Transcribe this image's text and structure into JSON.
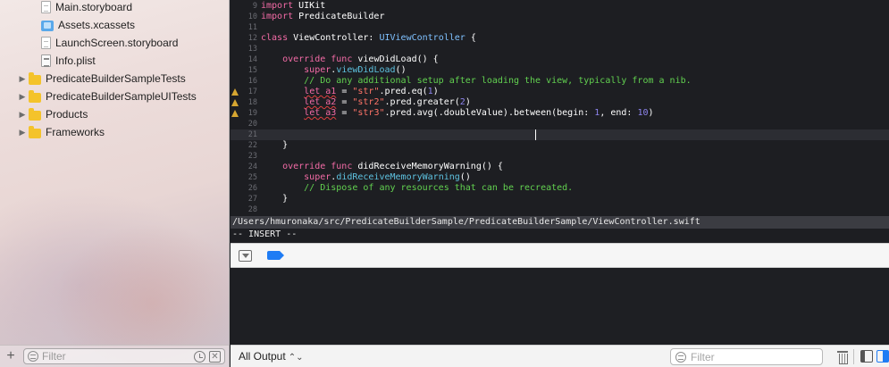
{
  "navigator": {
    "items": [
      {
        "label": "Main.storyboard",
        "icon": "storyboard-file-icon",
        "disclosure": ""
      },
      {
        "label": "Assets.xcassets",
        "icon": "asset-catalog-icon",
        "disclosure": ""
      },
      {
        "label": "LaunchScreen.storyboard",
        "icon": "storyboard-file-icon",
        "disclosure": ""
      },
      {
        "label": "Info.plist",
        "icon": "plist-file-icon",
        "disclosure": ""
      },
      {
        "label": "PredicateBuilderSampleTests",
        "icon": "folder-icon",
        "disclosure": "▶"
      },
      {
        "label": "PredicateBuilderSampleUITests",
        "icon": "folder-icon",
        "disclosure": "▶"
      },
      {
        "label": "Products",
        "icon": "folder-icon",
        "disclosure": "▶"
      },
      {
        "label": "Frameworks",
        "icon": "folder-icon",
        "disclosure": "▶"
      }
    ],
    "add_label": "+",
    "filter_placeholder": "Filter"
  },
  "editor": {
    "lines": [
      {
        "n": "9",
        "parts": [
          {
            "t": "import",
            "c": "kw"
          },
          {
            "t": " UIKit",
            "c": ""
          }
        ]
      },
      {
        "n": "10",
        "parts": [
          {
            "t": "import",
            "c": "kw"
          },
          {
            "t": " PredicateBuilder",
            "c": ""
          }
        ]
      },
      {
        "n": "11",
        "parts": []
      },
      {
        "n": "12",
        "parts": [
          {
            "t": "class",
            "c": "kw"
          },
          {
            "t": " ViewController: ",
            "c": ""
          },
          {
            "t": "UIViewController",
            "c": "ty"
          },
          {
            "t": " {",
            "c": ""
          }
        ]
      },
      {
        "n": "13",
        "parts": []
      },
      {
        "n": "14",
        "parts": [
          {
            "t": "    override func",
            "c": "kw"
          },
          {
            "t": " viewDidLoad() {",
            "c": ""
          }
        ]
      },
      {
        "n": "15",
        "parts": [
          {
            "t": "        super",
            "c": "kw"
          },
          {
            "t": ".",
            "c": ""
          },
          {
            "t": "viewDidLoad",
            "c": "fn"
          },
          {
            "t": "()",
            "c": ""
          }
        ]
      },
      {
        "n": "16",
        "parts": [
          {
            "t": "        // Do any additional setup after loading the view, typically from a nib.",
            "c": "cm"
          }
        ]
      },
      {
        "n": "17",
        "warn": true,
        "parts": [
          {
            "t": "        ",
            "c": ""
          },
          {
            "t": "let a1",
            "c": "kw wavy"
          },
          {
            "t": " = ",
            "c": ""
          },
          {
            "t": "\"str\"",
            "c": "str"
          },
          {
            "t": ".pred.eq(",
            "c": ""
          },
          {
            "t": "1",
            "c": "num"
          },
          {
            "t": ")",
            "c": ""
          }
        ]
      },
      {
        "n": "18",
        "warn": true,
        "parts": [
          {
            "t": "        ",
            "c": ""
          },
          {
            "t": "let a2",
            "c": "kw wavy"
          },
          {
            "t": " = ",
            "c": ""
          },
          {
            "t": "\"str2\"",
            "c": "str"
          },
          {
            "t": ".pred.greater(",
            "c": ""
          },
          {
            "t": "2",
            "c": "num"
          },
          {
            "t": ")",
            "c": ""
          }
        ]
      },
      {
        "n": "19",
        "warn": true,
        "parts": [
          {
            "t": "        ",
            "c": ""
          },
          {
            "t": "let a3",
            "c": "kw wavy"
          },
          {
            "t": " = ",
            "c": ""
          },
          {
            "t": "\"str3\"",
            "c": "str"
          },
          {
            "t": ".pred.avg(.doubleValue).between(begin: ",
            "c": ""
          },
          {
            "t": "1",
            "c": "num"
          },
          {
            "t": ", end: ",
            "c": ""
          },
          {
            "t": "10",
            "c": "num"
          },
          {
            "t": ")",
            "c": ""
          }
        ]
      },
      {
        "n": "20",
        "parts": []
      },
      {
        "n": "21",
        "current": true,
        "parts": []
      },
      {
        "n": "22",
        "parts": [
          {
            "t": "    }",
            "c": ""
          }
        ]
      },
      {
        "n": "23",
        "parts": []
      },
      {
        "n": "24",
        "parts": [
          {
            "t": "    override func",
            "c": "kw"
          },
          {
            "t": " didReceiveMemoryWarning() {",
            "c": ""
          }
        ]
      },
      {
        "n": "25",
        "parts": [
          {
            "t": "        super",
            "c": "kw"
          },
          {
            "t": ".",
            "c": ""
          },
          {
            "t": "didReceiveMemoryWarning",
            "c": "fn"
          },
          {
            "t": "()",
            "c": ""
          }
        ]
      },
      {
        "n": "26",
        "parts": [
          {
            "t": "        // Dispose of any resources that can be recreated.",
            "c": "cm"
          }
        ]
      },
      {
        "n": "27",
        "parts": [
          {
            "t": "    }",
            "c": ""
          }
        ]
      },
      {
        "n": "28",
        "parts": []
      }
    ],
    "file_path": "/Users/hmuronaka/src/PredicateBuilderSample/PredicateBuilderSample/ViewController.swift",
    "vim_mode": "-- INSERT --"
  },
  "debug": {
    "output_selector": "All Output",
    "filter_placeholder": "Filter"
  },
  "colors": {
    "keyword": "#f36ba6",
    "type": "#7fc1ff",
    "string": "#ff7468",
    "number": "#8e85ef",
    "comment": "#62d150",
    "accent": "#1f7cf4",
    "warning": "#d6a631"
  }
}
